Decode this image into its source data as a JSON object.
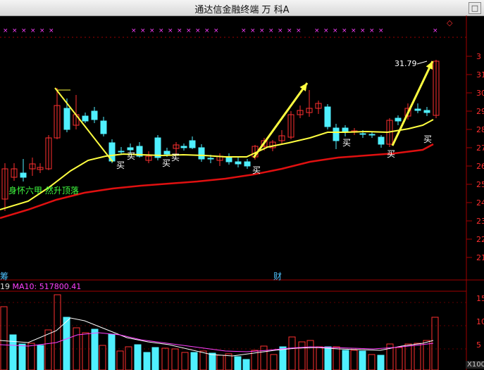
{
  "window": {
    "title": "通达信金融终端  万 科A",
    "close_symbol": "□"
  },
  "chart": {
    "pattern_label": "身怀六甲 然升顶落",
    "last_price_tag": "31.79",
    "finance_marker": "财",
    "left_cut_text": "筹",
    "buy_label": "买",
    "volume_legend": {
      "ma5_value": "19",
      "ma10_text": "MA10: 517800.41"
    },
    "volume_unit": "X100",
    "diamond": "◇",
    "price_ticks": [
      "3",
      "31",
      "30",
      "29",
      "28",
      "27",
      "26",
      "25",
      "24",
      "23",
      "22",
      "21"
    ],
    "volume_ticks": [
      "15",
      "10",
      "5"
    ],
    "colors": {
      "up": "#ff3030",
      "down": "#4ff0ff",
      "ma_short": "#ffff40",
      "ma_long": "#e01010",
      "grid": "#a00000",
      "arrow": "#ffff40",
      "vol_ma5": "#ffffff",
      "vol_ma10": "#ff40ff"
    }
  }
}
